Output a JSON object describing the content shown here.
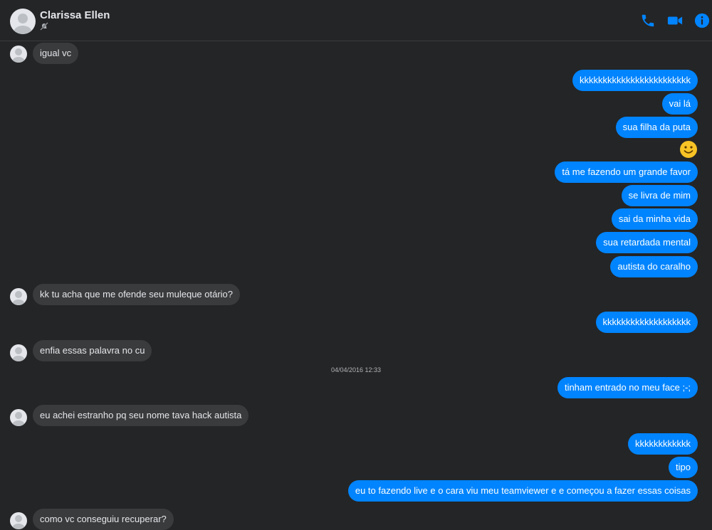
{
  "contact": {
    "name": "Clarissa Ellen",
    "status_icon": "muted-bell-icon"
  },
  "header_actions": [
    {
      "name": "phone-icon",
      "color": "#0084ff"
    },
    {
      "name": "video-camera-icon",
      "color": "#0084ff"
    },
    {
      "name": "info-icon",
      "color": "#0084ff"
    }
  ],
  "timestamp": "04/04/2016 12:33",
  "messages": [
    {
      "dir": "in",
      "text": "igual vc"
    },
    {
      "dir": "out",
      "text": "kkkkkkkkkkkkkkkkkkkkkkkk"
    },
    {
      "dir": "out",
      "text": "vai lá"
    },
    {
      "dir": "out",
      "text": "sua filha da puta"
    },
    {
      "dir": "out",
      "text": "🙂",
      "emoji": true
    },
    {
      "dir": "out",
      "text": "tá me fazendo um grande favor"
    },
    {
      "dir": "out",
      "text": "se livra de mim"
    },
    {
      "dir": "out",
      "text": "sai da minha vida"
    },
    {
      "dir": "out",
      "text": "sua retardada mental"
    },
    {
      "dir": "out",
      "text": "autista do caralho"
    },
    {
      "dir": "in",
      "text": "kk tu acha que me ofende seu muleque otário?"
    },
    {
      "dir": "out",
      "text": "kkkkkkkkkkkkkkkkkkk"
    },
    {
      "dir": "in",
      "text": "enfia essas palavra no cu"
    },
    {
      "dir": "out",
      "text": "tinham entrado no meu face ;-;"
    },
    {
      "dir": "in",
      "text": "eu achei estranho pq seu nome tava hack autista"
    },
    {
      "dir": "out",
      "text": "kkkkkkkkkkkk"
    },
    {
      "dir": "out",
      "text": "tipo"
    },
    {
      "dir": "out",
      "text": "eu to fazendo live e o cara viu meu teamviewer e e começou a fazer essas coisas"
    },
    {
      "dir": "in",
      "text": "como vc conseguiu recuperar?"
    }
  ]
}
